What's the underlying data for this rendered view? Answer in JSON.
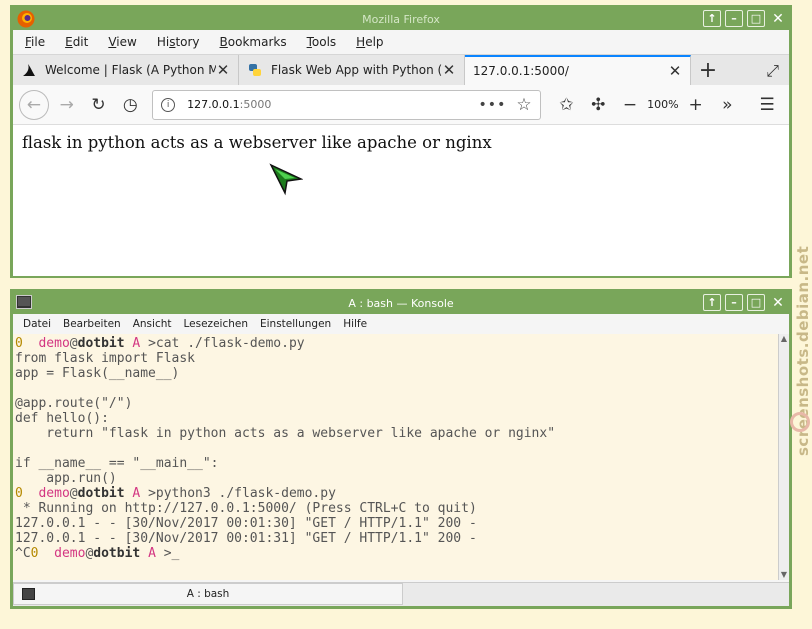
{
  "firefox": {
    "window_title": "Mozilla Firefox",
    "menu": [
      "File",
      "Edit",
      "View",
      "History",
      "Bookmarks",
      "Tools",
      "Help"
    ],
    "menu_accel": [
      "F",
      "E",
      "V",
      "s",
      "B",
      "T",
      "H"
    ],
    "tabs": [
      {
        "label": "Welcome | Flask (A Python Microfra",
        "icon": "flask-icon"
      },
      {
        "label": "Flask Web App with Python (beginne",
        "icon": "python-icon"
      },
      {
        "label": "127.0.0.1:5000/",
        "icon": ""
      }
    ],
    "url_host": "127.0.0.1",
    "url_port": ":5000",
    "zoom": "100%",
    "page_text": "flask in python acts as a webserver like apache or nginx"
  },
  "konsole": {
    "window_title": "A : bash — Konsole",
    "menu": [
      "Datei",
      "Bearbeiten",
      "Ansicht",
      "Lesezeichen",
      "Einstellungen",
      "Hilfe"
    ],
    "tab_label": "A : bash",
    "lines": [
      {
        "prompt": true,
        "status": "0",
        "user": "demo",
        "host": "dotbit",
        "dir": "A",
        "cmd": ">cat ./flask-demo.py"
      },
      {
        "text": "from flask import Flask"
      },
      {
        "text": "app = Flask(__name__)"
      },
      {
        "text": ""
      },
      {
        "text": "@app.route(\"/\")"
      },
      {
        "text": "def hello():"
      },
      {
        "text": "    return \"flask in python acts as a webserver like apache or nginx\""
      },
      {
        "text": ""
      },
      {
        "text": "if __name__ == \"__main__\":"
      },
      {
        "text": "    app.run()"
      },
      {
        "prompt": true,
        "status": "0",
        "user": "demo",
        "host": "dotbit",
        "dir": "A",
        "cmd": ">python3 ./flask-demo.py"
      },
      {
        "text": " * Running on http://127.0.0.1:5000/ (Press CTRL+C to quit)"
      },
      {
        "text": "127.0.0.1 - - [30/Nov/2017 00:01:30] \"GET / HTTP/1.1\" 200 -"
      },
      {
        "text": "127.0.0.1 - - [30/Nov/2017 00:01:31] \"GET / HTTP/1.1\" 200 -"
      },
      {
        "prompt": true,
        "prefix": "^C",
        "status": "0",
        "user": "demo",
        "host": "dotbit",
        "dir": "A",
        "cmd": ">_"
      }
    ]
  },
  "watermark": "screenshots.debian.net",
  "colors": {
    "window_border": "#79a65a",
    "desktop": "#fdf6d8",
    "terminal_bg": "#fdf6e3",
    "tab_accent": "#0a84ff"
  }
}
